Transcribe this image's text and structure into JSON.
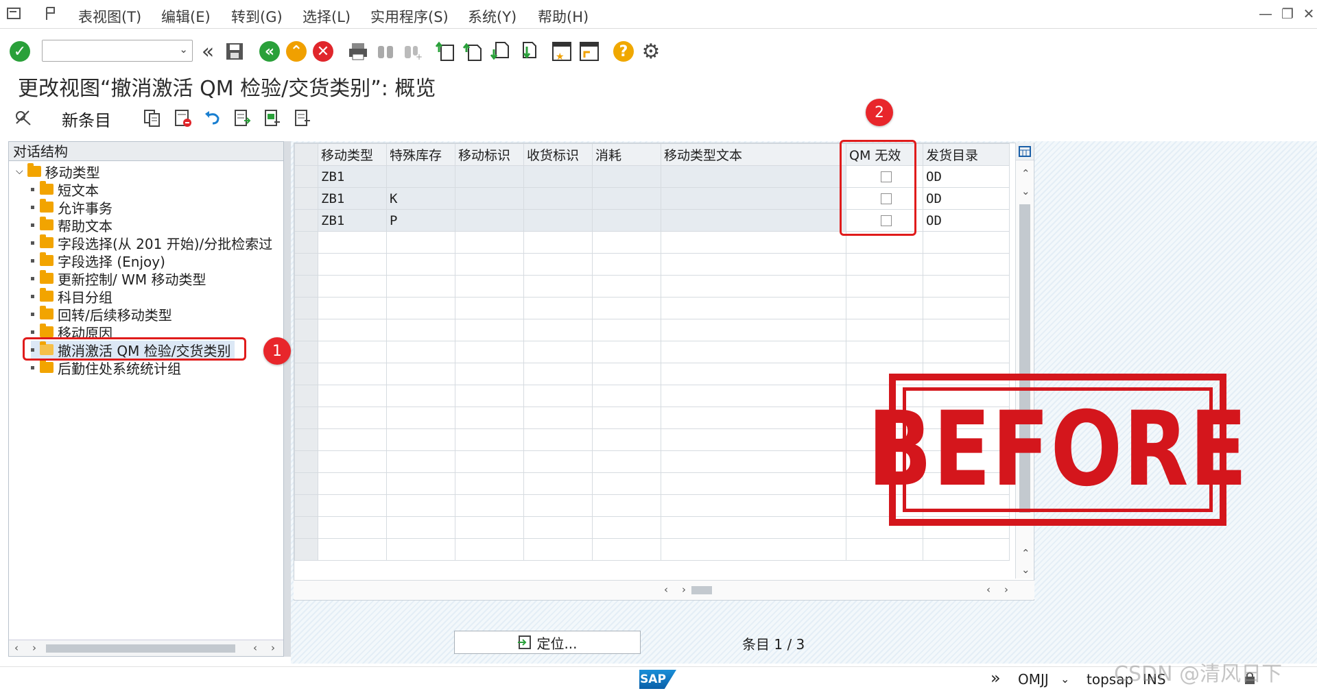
{
  "menubar": {
    "items": [
      "表视图(T)",
      "编辑(E)",
      "转到(G)",
      "选择(L)",
      "实用程序(S)",
      "系统(Y)",
      "帮助(H)"
    ]
  },
  "toolbar": {
    "command_field_value": "",
    "icons": [
      "enter-icon",
      "back-double-icon",
      "save-icon",
      "back-icon",
      "exit-icon",
      "cancel-icon",
      "print-icon",
      "find-icon",
      "find-next-icon",
      "first-page-icon",
      "prev-page-icon",
      "next-page-icon",
      "last-page-icon",
      "create-session-icon",
      "shortcut-icon",
      "help-icon",
      "settings-icon"
    ]
  },
  "page_title": "更改视图“撤消激活 QM 检验/交货类别”: 概览",
  "app_toolbar": {
    "new_entries_label": "新条目"
  },
  "tree": {
    "header": "对话结构",
    "root": "移动类型",
    "children": [
      "短文本",
      "允许事务",
      "帮助文本",
      "字段选择(从 201 开始)/分批检索过",
      "字段选择 (Enjoy)",
      "更新控制/ WM 移动类型",
      "科目分组",
      "回转/后续移动类型",
      "移动原因",
      "撤消激活 QM 检验/交货类别",
      "后勤住处系统统计组"
    ],
    "selected_index": 9
  },
  "table": {
    "columns": [
      "移动类型",
      "特殊库存",
      "移动标识",
      "收货标识",
      "消耗",
      "移动类型文本",
      "QM 无效",
      "发货目录"
    ],
    "rows": [
      {
        "mvt": "ZB1",
        "special": "",
        "move_ind": "",
        "recv_ind": "",
        "consumption": "",
        "text": "",
        "qm_inactive": false,
        "delivery": "OD"
      },
      {
        "mvt": "ZB1",
        "special": "K",
        "move_ind": "",
        "recv_ind": "",
        "consumption": "",
        "text": "",
        "qm_inactive": false,
        "delivery": "OD"
      },
      {
        "mvt": "ZB1",
        "special": "P",
        "move_ind": "",
        "recv_ind": "",
        "consumption": "",
        "text": "",
        "qm_inactive": false,
        "delivery": "OD"
      }
    ]
  },
  "annotations": {
    "badge1": "1",
    "badge2": "2",
    "stamp_text": "BEFORE"
  },
  "footer": {
    "locate_button": "定位...",
    "entry_info": "条目 1 / 3"
  },
  "statusbar": {
    "transaction": "OMJJ",
    "server": "topsap",
    "mode": "INS",
    "sap_logo": "SAP"
  },
  "watermark": "CSDN @清风日下",
  "colors": {
    "annotation_red": "#e01b1b",
    "stamp_red": "#d4161c",
    "folder": "#f2a400",
    "sap_blue": "#0a5fa8"
  }
}
